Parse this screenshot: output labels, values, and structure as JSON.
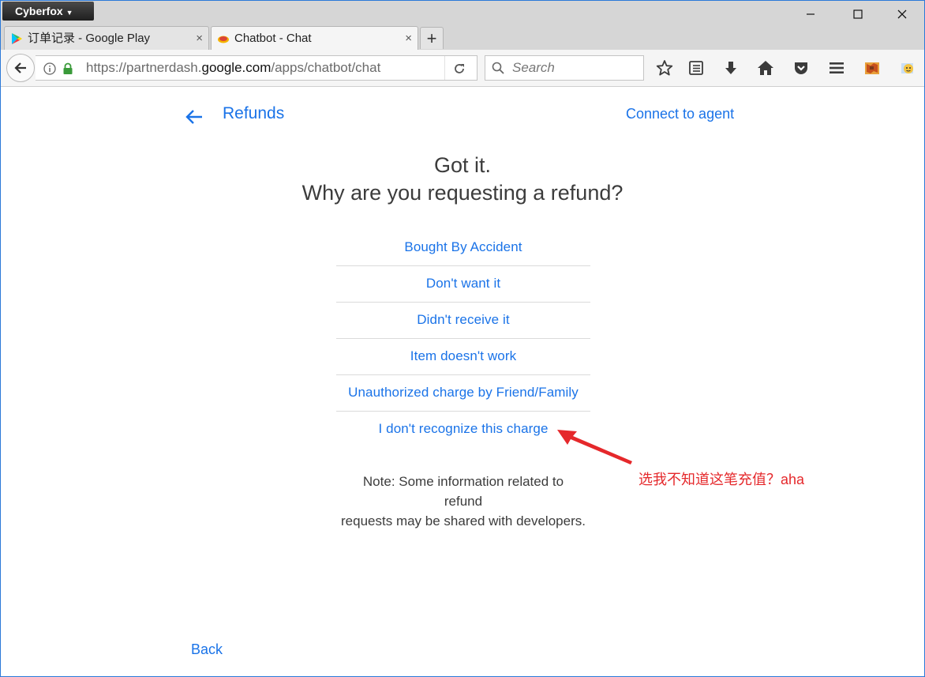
{
  "browser": {
    "app_name": "Cyberfox",
    "window_controls": {
      "minimize": "—",
      "maximize": "☐",
      "close": "✕"
    },
    "tabs": [
      {
        "label": "订单记录 - Google Play",
        "close": "×",
        "icon": "google-play-icon"
      },
      {
        "label": "Chatbot - Chat",
        "close": "×",
        "icon": "chatbot-icon"
      }
    ],
    "new_tab": "+",
    "url": {
      "prefix": "https://partnerdash.",
      "domain": "google.com",
      "rest": "/apps/chatbot/chat"
    },
    "search_placeholder": "Search",
    "back": "←",
    "reload": "↻"
  },
  "page": {
    "title": "Refunds",
    "connect_label": "Connect to agent",
    "heading_line1": "Got it.",
    "heading_line2": "Why are you requesting a refund?",
    "options": [
      "Bought By Accident",
      "Don't want it",
      "Didn't receive it",
      "Item doesn't work",
      "Unauthorized charge by Friend/Family",
      "I don't recognize this charge"
    ],
    "note_line1": "Note: Some information related to",
    "note_line2": "refund",
    "note_line3": "requests may be shared with developers.",
    "back_label": "Back"
  },
  "annotation": {
    "text": "选我不知道这笔充值？aha",
    "color": "#e5282b"
  },
  "colors": {
    "accent": "#1a73e8",
    "text": "#3c3c3c",
    "window_border": "#2b79d8"
  }
}
